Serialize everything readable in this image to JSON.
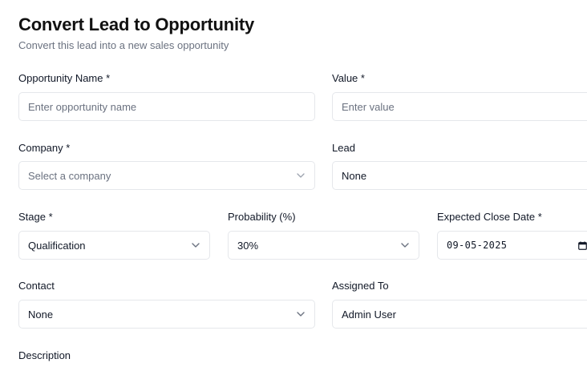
{
  "header": {
    "title": "Convert Lead to Opportunity",
    "subtitle": "Convert this lead into a new sales opportunity"
  },
  "form": {
    "opportunity_name": {
      "label": "Opportunity Name *",
      "placeholder": "Enter opportunity name",
      "value": ""
    },
    "value": {
      "label": "Value *",
      "placeholder": "Enter value",
      "value": ""
    },
    "company": {
      "label": "Company *",
      "placeholder": "Select a company",
      "icon": "chevron-down-icon"
    },
    "lead": {
      "label": "Lead",
      "value": "None"
    },
    "stage": {
      "label": "Stage *",
      "value": "Qualification",
      "icon": "chevron-down-icon"
    },
    "probability": {
      "label": "Probability (%)",
      "value": "30%",
      "icon": "chevron-down-icon"
    },
    "expected_close_date": {
      "label": "Expected Close Date *",
      "value": "09-05-2025",
      "icon": "calendar-icon"
    },
    "contact": {
      "label": "Contact",
      "value": "None",
      "icon": "chevron-down-icon"
    },
    "assigned_to": {
      "label": "Assigned To",
      "value": "Admin User"
    },
    "description": {
      "label": "Description"
    }
  },
  "colors": {
    "border": "#e5e7eb",
    "placeholder": "#6b7280",
    "text": "#111827"
  }
}
